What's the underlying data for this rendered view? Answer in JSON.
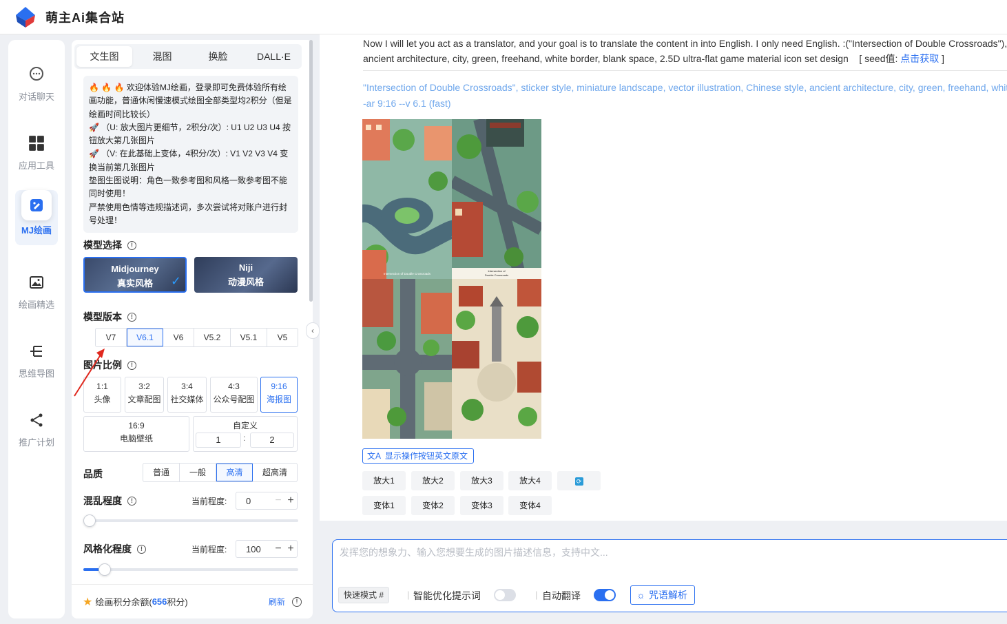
{
  "header": {
    "brand": "萌主Ai集合站"
  },
  "nav": [
    {
      "label": "对话聊天",
      "icon": "chat-icon"
    },
    {
      "label": "应用工具",
      "icon": "grid-icon"
    },
    {
      "label": "MJ绘画",
      "icon": "paint-icon",
      "active": true
    },
    {
      "label": "绘画精选",
      "icon": "gallery-icon"
    },
    {
      "label": "思维导图",
      "icon": "mindmap-icon"
    },
    {
      "label": "推广计划",
      "icon": "share-icon"
    }
  ],
  "panel": {
    "tabs": [
      "文生图",
      "混图",
      "换脸",
      "DALL·E"
    ],
    "notice": {
      "line1": "欢迎体验MJ绘画，登录即可免费体验所有绘画功能，普通休闲慢速模式绘图全部类型均2积分（但是绘画时间比较长）",
      "line2": "（U: 放大图片更细节，2积分/次）: U1 U2 U3 U4 按钮放大第几张图片",
      "line3": "（V: 在此基础上变体，4积分/次）: V1 V2 V3 V4 变换当前第几张图片",
      "line4": "垫图生图说明：角色一致参考图和风格一致参考图不能同时使用！",
      "line5": "严禁使用色情等违规描述词，多次尝试将对账户进行封号处理！"
    },
    "model_section": "模型选择",
    "models": [
      {
        "name": "Midjourney",
        "sub": "真实风格"
      },
      {
        "name": "Niji",
        "sub": "动漫风格"
      }
    ],
    "version_section": "模型版本",
    "versions": [
      "V7",
      "V6.1",
      "V6",
      "V5.2",
      "V5.1",
      "V5"
    ],
    "selected_version": "V6.1",
    "ratio_section": "图片比例",
    "ratios": [
      {
        "r": "1:1",
        "d": "头像"
      },
      {
        "r": "3:2",
        "d": "文章配图"
      },
      {
        "r": "3:4",
        "d": "社交媒体"
      },
      {
        "r": "4:3",
        "d": "公众号配图"
      },
      {
        "r": "9:16",
        "d": "海报图"
      },
      {
        "r": "16:9",
        "d": "电脑壁纸"
      }
    ],
    "custom": {
      "label": "自定义",
      "w": "1",
      "h": "2"
    },
    "quality_section": "品质",
    "qualities": [
      "普通",
      "一般",
      "高清",
      "超高清"
    ],
    "selected_quality": "高清",
    "chaos": {
      "label": "混乱程度",
      "current_label": "当前程度:",
      "value": "0",
      "level": 0.0
    },
    "stylize": {
      "label": "风格化程度",
      "current_label": "当前程度:",
      "value": "100",
      "level": 0.1
    },
    "credits": {
      "label": "绘画积分余额(",
      "amount": "656",
      "unit": "积分)",
      "refresh": "刷新"
    }
  },
  "result": {
    "prompt_line1": "Now I will let you act as a translator, and your goal is to translate the content in into English. I only need English. :(\"Intersection of Double Crossroads\"),",
    "prompt_line2": "ancient architecture, city, green, freehand, white border, blank space, 2.5D ultra-flat game material icon set design",
    "seed_label": "[ seed值:",
    "seed_link": "点击获取",
    "seed_close": "]",
    "prompt_en": "\"Intersection of Double Crossroads\", sticker style, miniature landscape, vector illustration, Chinese style, ancient architecture, city, green, freehand, white",
    "params": "-ar 9:16 --v 6.1  (fast)",
    "caption_a": "Intersection of Double Crossroads",
    "caption_b1": "Intersection of",
    "caption_b2": "Double Crossroads",
    "show_en_btn": "显示操作按钮英文原文",
    "upscale": [
      "放大1",
      "放大2",
      "放大3",
      "放大4"
    ],
    "variation": [
      "变体1",
      "变体2",
      "变体3",
      "变体4"
    ]
  },
  "composer": {
    "placeholder": "发挥您的想象力、输入您想要生成的图片描述信息，支持中文...",
    "fast_mode": "快速模式 #",
    "smart_label": "智能优化提示词",
    "smart_on": false,
    "translate_label": "自动翻译",
    "translate_on": true,
    "spell_btn": "咒语解析"
  },
  "colors": {
    "accent": "#2a6ff0",
    "nav_text": "#8a8f99"
  }
}
